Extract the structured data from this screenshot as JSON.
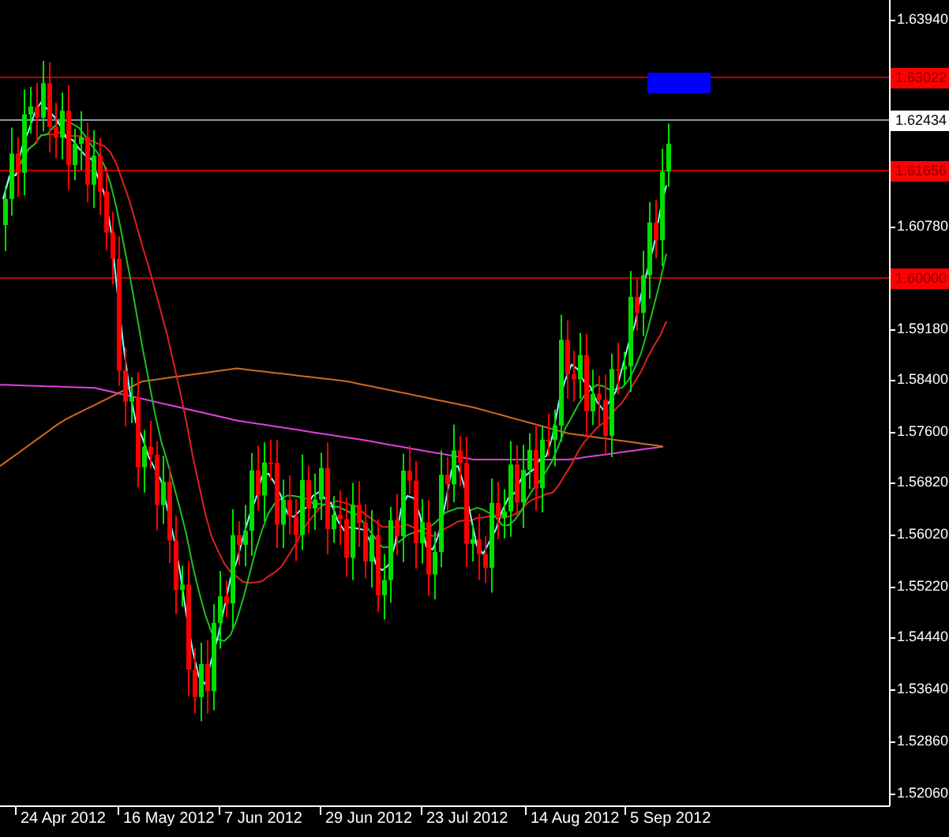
{
  "price_axis": {
    "ticks": [
      "1.63940",
      "1.60780",
      "1.59180",
      "1.58400",
      "1.57600",
      "1.56820",
      "1.56020",
      "1.55220",
      "1.54440",
      "1.53640",
      "1.52860",
      "1.52060"
    ]
  },
  "price_lines": [
    {
      "kind": "level",
      "label": "1.63022"
    },
    {
      "kind": "bid",
      "label": "1.62434"
    },
    {
      "kind": "level",
      "label": "1.61656"
    },
    {
      "kind": "level",
      "label": "1.60000"
    }
  ],
  "time_axis": {
    "ticks": [
      "24 Apr 2012",
      "16 May 2012",
      "7 Jun 2012",
      "29 Jun 2012",
      "23 Jul 2012",
      "14 Aug 2012",
      "5 Sep 2012"
    ]
  }
}
